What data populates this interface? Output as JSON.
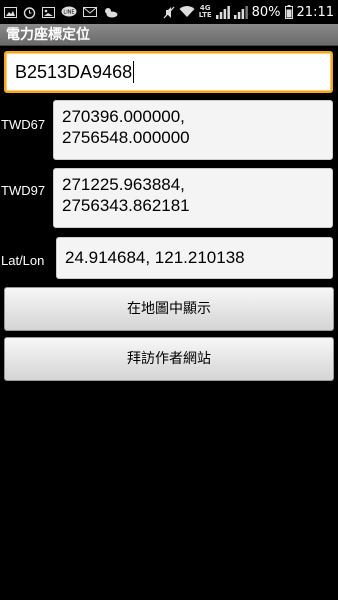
{
  "status_bar": {
    "battery_percent": "80%",
    "time": "21:11",
    "network_type": "4G",
    "network_sub": "LTE",
    "icons": [
      "image-icon",
      "alarm-clock-icon",
      "gallery-icon",
      "line-app-icon",
      "mail-icon",
      "weather-icon",
      "mute-icon",
      "wifi-icon",
      "signal-icon",
      "battery-icon"
    ]
  },
  "app": {
    "title": "電力座標定位"
  },
  "code_input": {
    "value": "B2513DA9468"
  },
  "twd67": {
    "label": "TWD67",
    "value": "270396.000000,\n2756548.000000"
  },
  "twd97": {
    "label": "TWD97",
    "value": "271225.963884,\n2756343.862181"
  },
  "latlon": {
    "label": "Lat/Lon",
    "value": "24.914684, 121.210138"
  },
  "buttons": {
    "show_map": "在地圖中顯示",
    "visit_author": "拜訪作者網站"
  }
}
